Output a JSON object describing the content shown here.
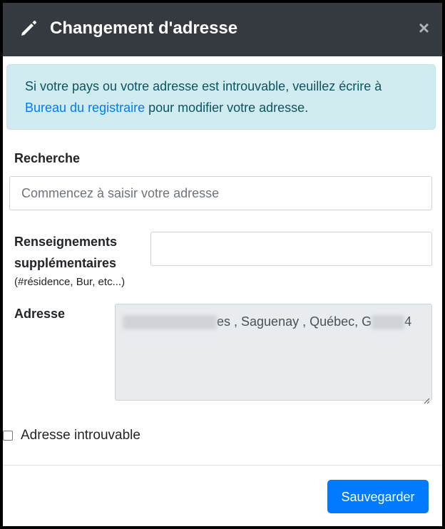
{
  "modal": {
    "title": "Changement d'adresse",
    "close_symbol": "×",
    "header_icon": "pencil-icon",
    "close_icon": "close-icon"
  },
  "alert": {
    "text_before": "Si votre pays ou votre adresse est introuvable, veuillez écrire à ",
    "link_text": "Bureau du registraire",
    "text_after": " pour modifier votre adresse."
  },
  "form": {
    "search_label": "Recherche",
    "search_placeholder": "Commencez à saisir votre adresse",
    "extra_label_line1": "Renseignements",
    "extra_label_line2": "supplémentaires",
    "extra_hint": "(#résidence, Bur, etc...)",
    "extra_value": "",
    "address_label": "Adresse",
    "address_visible_part": "es , Saguenay , Québec, G",
    "address_end": "4",
    "checkbox_label": "Adresse introuvable",
    "checkbox_checked": false
  },
  "footer": {
    "save_label": "Sauvegarder"
  },
  "colors": {
    "header_bg": "#343a40",
    "alert_bg": "#d1ecf1",
    "link": "#007bff",
    "primary": "#007bff",
    "readonly_bg": "#e9ecef"
  }
}
